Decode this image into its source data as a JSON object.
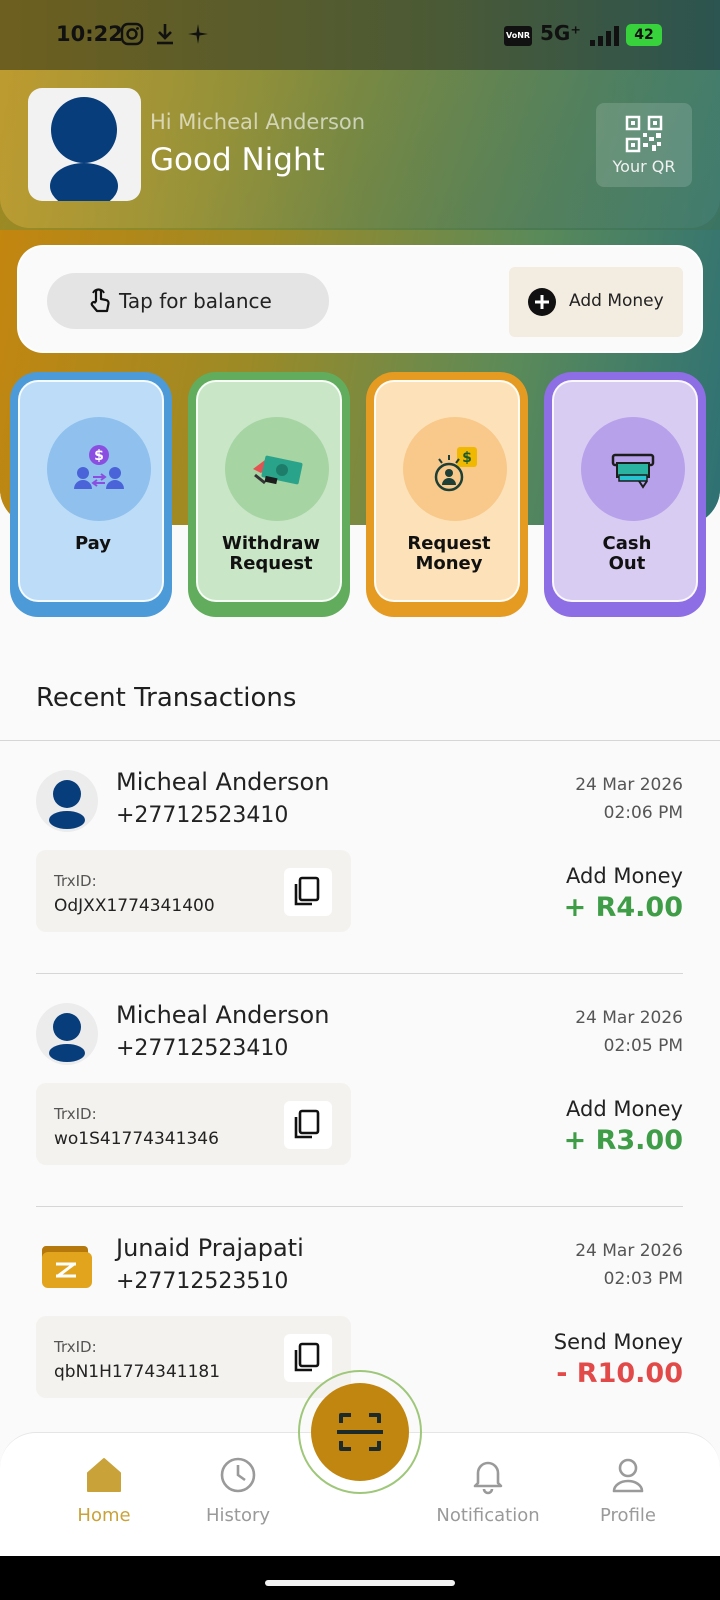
{
  "status_bar": {
    "time": "10:22",
    "network": "5G⁺",
    "vonr": "VoNR",
    "battery": "42"
  },
  "header": {
    "greeting": "Hi Micheal Anderson",
    "salutation": "Good Night",
    "qr_label": "Your QR"
  },
  "balance_card": {
    "tap_label": "Tap for balance",
    "add_money_label": "Add Money"
  },
  "actions": [
    {
      "label": "Pay",
      "bg": "#bddcf7",
      "ring": "#4d9ad8"
    },
    {
      "label": "Withdraw\nRequest",
      "bg": "#c9e6c7",
      "ring": "#62ad5d"
    },
    {
      "label": "Request\nMoney",
      "bg": "#fde2b9",
      "ring": "#e59a22"
    },
    {
      "label": "Cash\nOut",
      "bg": "#d8ccf2",
      "ring": "#8e6ee4"
    }
  ],
  "recent": {
    "title": "Recent Transactions",
    "items": [
      {
        "name": "Micheal Anderson",
        "phone": "+27712523410",
        "date": "24 Mar 2026",
        "time": "02:06 PM",
        "trx_key": "TrxID:",
        "trx_id": "OdJXX1774341400",
        "type": "Add Money",
        "amount": "+ R4.00",
        "amount_color": "#3f9d47"
      },
      {
        "name": "Micheal Anderson",
        "phone": "+27712523410",
        "date": "24 Mar 2026",
        "time": "02:05 PM",
        "trx_key": "TrxID:",
        "trx_id": "wo1S41774341346",
        "type": "Add Money",
        "amount": "+ R3.00",
        "amount_color": "#3f9d47"
      },
      {
        "name": "Junaid Prajapati",
        "phone": "+27712523510",
        "date": "24 Mar 2026",
        "time": "02:03 PM",
        "trx_key": "TrxID:",
        "trx_id": "qbN1H1774341181",
        "type": "Send Money",
        "amount": "- R10.00",
        "amount_color": "#e24a4a"
      }
    ]
  },
  "nav": {
    "home": "Home",
    "history": "History",
    "notification": "Notification",
    "profile": "Profile",
    "active_color": "#c9a23a",
    "inactive_color": "#9a9a9a"
  }
}
